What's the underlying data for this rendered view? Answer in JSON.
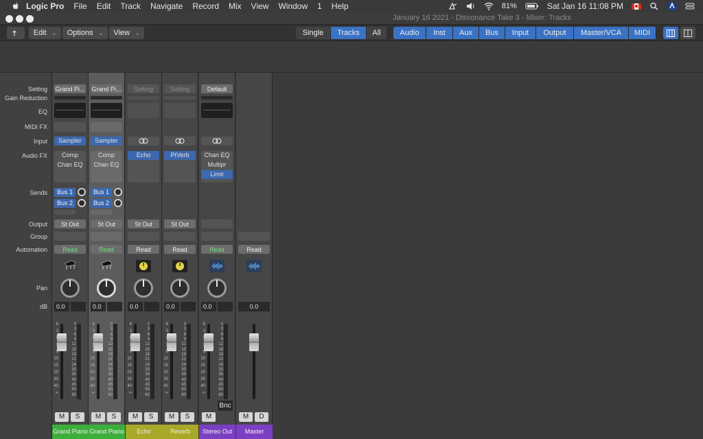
{
  "menubar": {
    "app": "Logic Pro",
    "items": [
      "File",
      "Edit",
      "Track",
      "Navigate",
      "Record",
      "Mix",
      "View",
      "Window",
      "1",
      "Help"
    ],
    "battery": "81%",
    "clock": "Sat Jan 16  11:08 PM"
  },
  "window": {
    "title": "January 16 2021 - Dissonance Take 3 - Mixer: Tracks"
  },
  "toolbar": {
    "edit": "Edit",
    "options": "Options",
    "view": "View",
    "view_modes": [
      "Single",
      "Tracks",
      "All"
    ],
    "selected_mode": "Tracks",
    "filters": [
      "Audio",
      "Inst",
      "Aux",
      "Bus",
      "Input",
      "Output",
      "Master/VCA",
      "MIDI"
    ]
  },
  "row_labels": {
    "setting": "Setting",
    "gain_reduction": "Gain Reduction",
    "eq": "EQ",
    "midi_fx": "MIDI FX",
    "input": "Input",
    "audio_fx": "Audio FX",
    "sends": "Sends",
    "output": "Output",
    "group": "Group",
    "automation": "Automation",
    "pan": "Pan",
    "db": "dB"
  },
  "strips": [
    {
      "name": "Grand Piano",
      "color": "#3cae3c",
      "setting": "Grand Pi...",
      "input": "Sampler",
      "fx": [
        "Comp",
        "Chan EQ"
      ],
      "sends": [
        "Bus 1",
        "Bus 2"
      ],
      "output": "St Out",
      "automation": "Read",
      "db": "0.0",
      "icon": "piano-icon",
      "m": "M",
      "s": "S"
    },
    {
      "name": "Grand Piano",
      "color": "#3cae3c",
      "setting": "Grand Pi...",
      "input": "Sampler",
      "fx": [
        "Comp",
        "Chan EQ"
      ],
      "sends": [
        "Bus 1",
        "Bus 2"
      ],
      "output": "St Out",
      "automation": "Read",
      "db": "0.0",
      "icon": "piano-icon",
      "m": "M",
      "s": "S"
    },
    {
      "name": "Echo",
      "color": "#a8a829",
      "setting": "Setting",
      "input": "",
      "fx": [
        "Echo"
      ],
      "sends": [],
      "output": "St Out",
      "automation": "Read",
      "db": "0.0",
      "icon": "knob-icon",
      "m": "M",
      "s": "S"
    },
    {
      "name": "Reverb",
      "color": "#a8a829",
      "setting": "Setting",
      "input": "",
      "fx": [
        "PtVerb"
      ],
      "sends": [],
      "output": "St Out",
      "automation": "Read",
      "db": "0.0",
      "icon": "knob-icon",
      "m": "M",
      "s": "S"
    },
    {
      "name": "Stereo Out",
      "color": "#7b3fc2",
      "setting": "Default",
      "input": "",
      "fx": [
        "Chan EQ",
        "Multipr",
        "Limit"
      ],
      "sends": [],
      "output": "",
      "automation": "Read",
      "db": "0.0",
      "icon": "waveform-icon",
      "m": "M",
      "s": "",
      "bnc": "Bnc"
    },
    {
      "name": "Master",
      "color": "#7b3fc2",
      "setting": "",
      "input": "",
      "fx": [],
      "sends": [],
      "output": "",
      "automation": "Read",
      "db": "0.0",
      "icon": "waveform-icon",
      "m": "M",
      "s": "D"
    }
  ],
  "fader_scale": [
    "6",
    "3",
    "0",
    "3",
    "6",
    "10",
    "15",
    "20",
    "30",
    "40",
    "∞"
  ],
  "meter_scale": [
    "0",
    "3",
    "6",
    "9",
    "12",
    "15",
    "18",
    "21",
    "24",
    "30",
    "35",
    "40",
    "45",
    "50",
    "60"
  ]
}
